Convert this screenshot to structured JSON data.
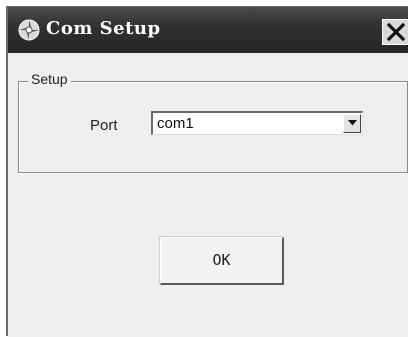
{
  "window": {
    "title": "Com Setup",
    "icons": {
      "app": "gear-disc-icon",
      "close": "close-icon"
    }
  },
  "setup_group": {
    "legend": "Setup",
    "port_label": "Port",
    "port_value": "com1"
  },
  "buttons": {
    "ok_label": "OK"
  },
  "colors": {
    "titlebar": "#2e2e2e",
    "client": "#efefef"
  }
}
